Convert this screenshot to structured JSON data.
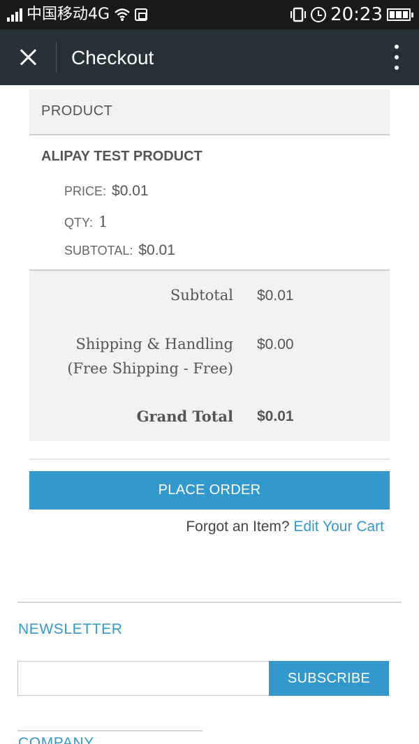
{
  "status_bar": {
    "carrier": "中国移动4G",
    "time": "20:23",
    "icons": [
      "signal-icon",
      "wifi-icon",
      "sim-icon",
      "vibrate-icon",
      "alarm-icon",
      "battery-icon"
    ]
  },
  "app_bar": {
    "title": "Checkout",
    "icons": [
      "close-icon",
      "more-vert-icon"
    ]
  },
  "order_review": {
    "column_header": "PRODUCT",
    "items": [
      {
        "name": "ALIPAY TEST PRODUCT",
        "price_label": "PRICE:",
        "price": "$0.01",
        "qty_label": "QTY:",
        "qty": "1",
        "subtotal_label": "SUBTOTAL:",
        "subtotal": "$0.01"
      }
    ],
    "totals": {
      "subtotal_label": "Subtotal",
      "subtotal": "$0.01",
      "shipping_label_line1": "Shipping & Handling",
      "shipping_label_line2": "(Free Shipping - Free)",
      "shipping": "$0.00",
      "grand_total_label": "Grand Total",
      "grand_total": "$0.01"
    }
  },
  "actions": {
    "place_order_label": "PLACE ORDER",
    "forgot_text": "Forgot an Item?",
    "edit_cart_link": "Edit Your Cart"
  },
  "footer": {
    "newsletter_title": "NEWSLETTER",
    "email_value": "",
    "subscribe_label": "SUBSCRIBE",
    "company_title": "COMPANY"
  },
  "colors": {
    "accent": "#3399cc",
    "app_bar_bg": "#263238",
    "status_bar_bg": "#1a1a1a",
    "panel_bg": "#f2f2f2"
  }
}
